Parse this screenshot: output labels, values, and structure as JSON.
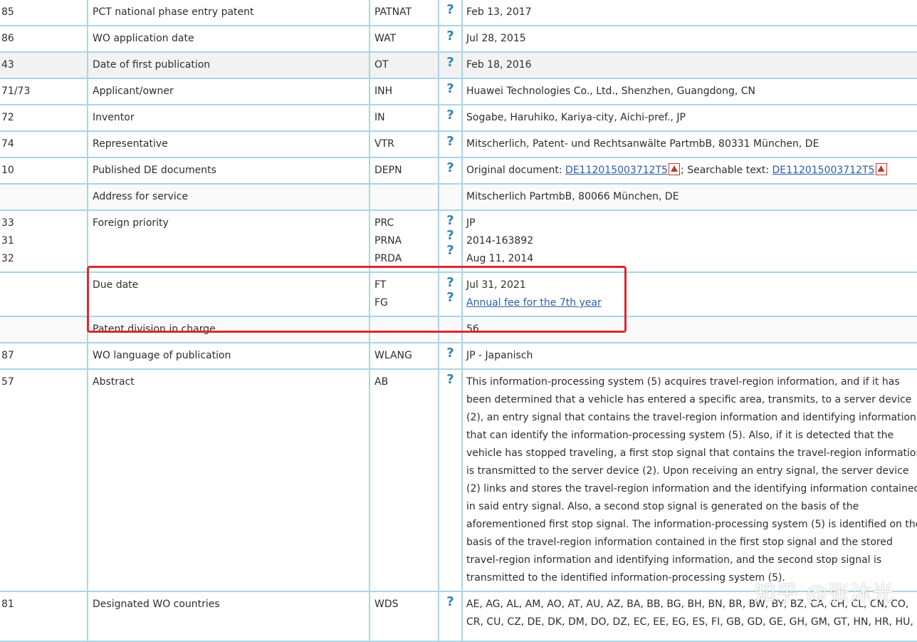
{
  "rows": [
    {
      "inid": "85",
      "criterion": "PCT national phase entry patent",
      "code": "PATNAT",
      "value": "Feb 13, 2017"
    },
    {
      "inid": "86",
      "criterion": "WO application date",
      "code": "WAT",
      "value": "Jul 28, 2015"
    },
    {
      "inid": "43",
      "criterion": "Date of first publication",
      "code": "OT",
      "value": "Feb 18, 2016"
    },
    {
      "inid": "71/73",
      "criterion": "Applicant/owner",
      "code": "INH",
      "value": "Huawei Technologies Co., Ltd., Shenzhen, Guangdong, CN"
    },
    {
      "inid": "72",
      "criterion": "Inventor",
      "code": "IN",
      "value": "Sogabe, Haruhiko, Kariya-city, Aichi-pref., JP"
    },
    {
      "inid": "74",
      "criterion": "Representative",
      "code": "VTR",
      "value": "Mitscherlich, Patent- und Rechtsanwälte PartmbB, 80331 München, DE"
    },
    {
      "inid": "10",
      "criterion": "Published DE documents",
      "code": "DEPN",
      "original_label": "Original document: ",
      "original_link": "DE112015003712T5",
      "searchable_label": "; Searchable text: ",
      "searchable_link": "DE112015003712T5"
    },
    {
      "inid": "",
      "criterion": "Address for service",
      "code": "",
      "value": "Mitscherlich PartmbB, 80066 München, DE"
    },
    {
      "inid": [
        "33",
        "31",
        "32"
      ],
      "criterion": "Foreign priority",
      "code": [
        "PRC",
        "PRNA",
        "PRDA"
      ],
      "value": [
        "JP",
        "2014-163892",
        "Aug 11, 2014"
      ]
    },
    {
      "inid": "",
      "criterion": "Due date",
      "code": [
        "FT",
        "FG"
      ],
      "value": "Jul 31, 2021",
      "link": "Annual fee for the 7th year"
    },
    {
      "inid": "",
      "criterion": "Patent division in charge",
      "code": "",
      "value": "56"
    },
    {
      "inid": "87",
      "criterion": "WO language of publication",
      "code": "WLANG",
      "value": "JP - Japanisch"
    },
    {
      "inid": "57",
      "criterion": "Abstract",
      "code": "AB",
      "value": "This information-processing system (5) acquires travel-region information, and if it has been determined that a vehicle has entered a specific area, transmits, to a server device (2), an entry signal that contains the travel-region information and identifying information that can identify the information-processing system (5). Also, if it is detected that the vehicle has stopped traveling, a first stop signal that contains the travel-region information is transmitted to the server device (2). Upon receiving an entry signal, the server device (2) links and stores the travel-region information and the identifying information contained in said entry signal. Also, a second stop signal is generated on the basis of the aforementioned first stop signal. The information-processing system (5) is identified on the basis of the travel-region information contained in the first stop signal and the stored travel-region information and identifying information, and the second stop signal is transmitted to the identified information-processing system (5)."
    },
    {
      "inid": "81",
      "criterion": "Designated WO countries",
      "code": "WDS",
      "value": "AE, AG, AL, AM, AO, AT, AU, AZ, BA, BB, BG, BH, BN, BR, BW, BY, BZ, CA, CH, CL, CN, CO, CR, CU, CZ, DE, DK, DM, DO, DZ, EC, EE, EG, ES, FI, GB, GD, GE, GH, GM, GT, HN, HR, HU,"
    }
  ],
  "help_glyph": "?",
  "watermark": "知乎 @张沐光",
  "colors": {
    "border": "#a9d6e5",
    "help": "#2b8aa8",
    "link": "#2a5fa8",
    "highlight": "#e0262c"
  }
}
